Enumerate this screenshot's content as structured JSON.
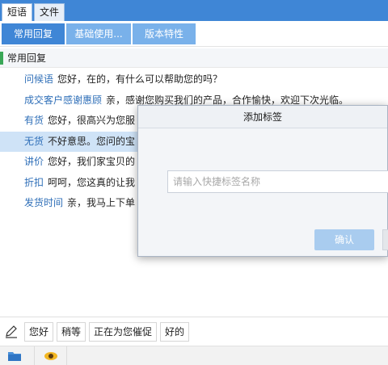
{
  "tabs": [
    {
      "label": "短语"
    },
    {
      "label": "文件"
    }
  ],
  "subtabs": [
    {
      "label": "常用回复"
    },
    {
      "label": "基础使用..."
    },
    {
      "label": "版本特性"
    }
  ],
  "section": {
    "title": "常用回复"
  },
  "replies": [
    {
      "key": "问候语",
      "text": "您好，在的，有什么可以帮助您的吗？"
    },
    {
      "key": "成交客户感谢惠顾",
      "text": "亲，感谢您购买我们的产品，合作愉快，欢迎下次光临。"
    },
    {
      "key": "有货",
      "text": "您好，很高兴为您服"
    },
    {
      "key": "无货",
      "text": "不好意思。您问的宝"
    },
    {
      "key": "讲价",
      "text": "您好，我们家宝贝的"
    },
    {
      "key": "折扣",
      "text": "呵呵，您这真的让我"
    },
    {
      "key": "发货时间",
      "text": "亲，我马上下单"
    }
  ],
  "quick_chips": [
    {
      "label": "您好"
    },
    {
      "label": "稍等"
    },
    {
      "label": "正在为您催促"
    },
    {
      "label": "好的"
    }
  ],
  "dialog": {
    "title": "添加标签",
    "input_placeholder": "请输入快捷标签名称",
    "confirm_label": "确认"
  },
  "icons": {
    "edit": "pencil-icon",
    "folder": "folder-icon",
    "eye": "eye-icon"
  },
  "colors": {
    "accent": "#3f86d6",
    "accent_light": "#79b1ea",
    "link": "#2f6fb8",
    "selected_row": "#cfe3f7",
    "section_marker": "#3aa757"
  }
}
